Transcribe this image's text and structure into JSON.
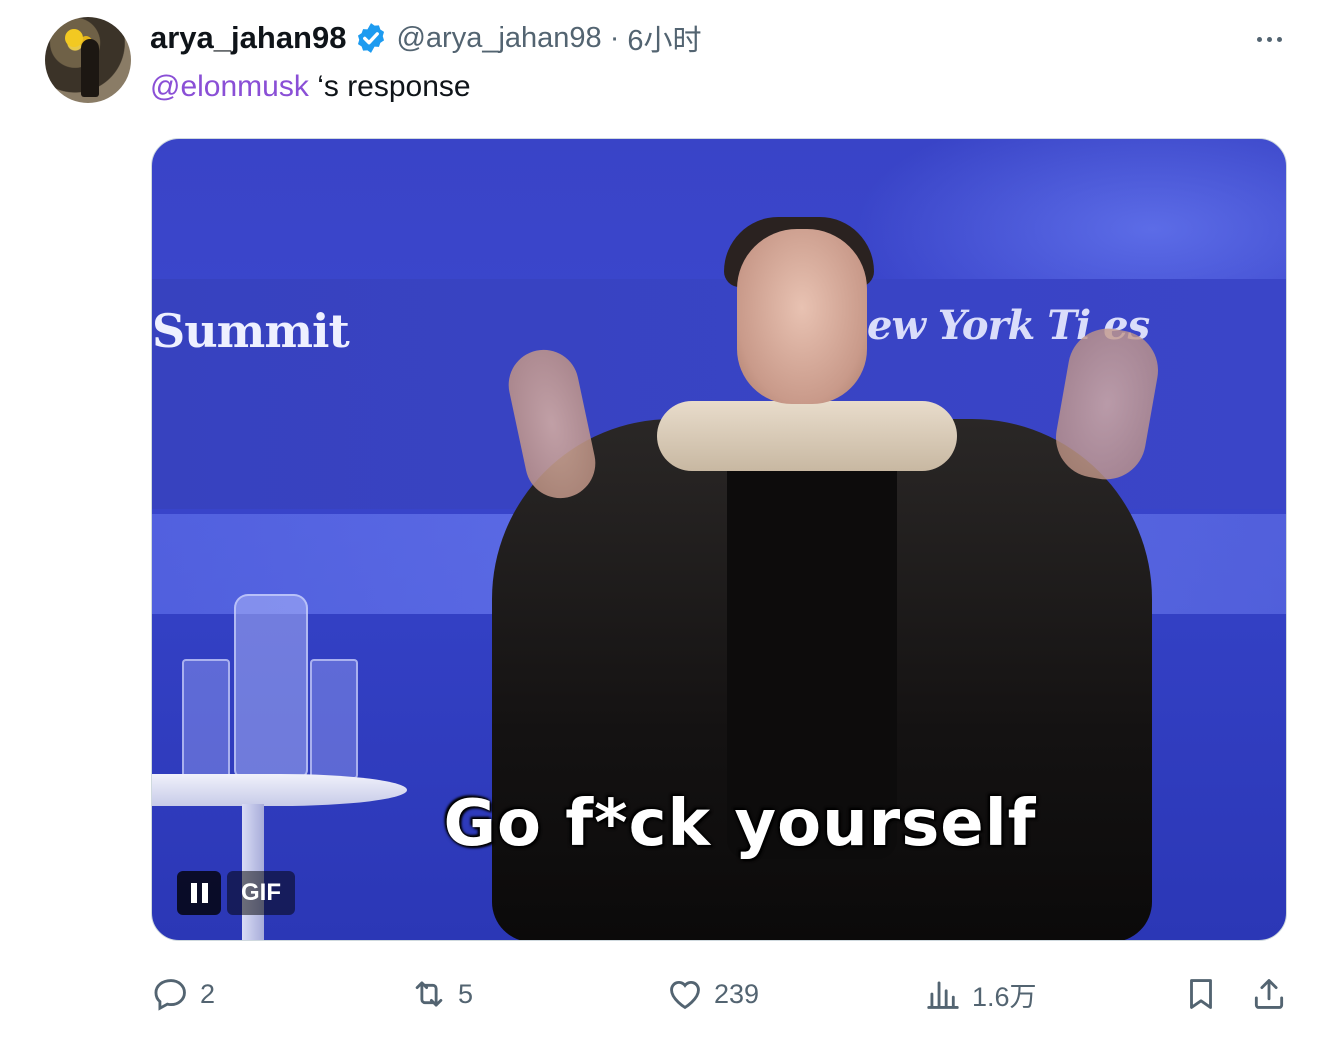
{
  "tweet": {
    "display_name": "arya_jahan98",
    "handle": "@arya_jahan98",
    "separator": "·",
    "time": "6小时",
    "mention": "@elonmusk",
    "text_rest": " ‘s response",
    "verified": true
  },
  "media": {
    "badge": "GIF",
    "caption": "Go f*ck yourself",
    "backdrop_left_text": "Summit",
    "backdrop_right_text": "ew York Ti  es"
  },
  "actions": {
    "replies": "2",
    "reposts": "5",
    "likes": "239",
    "views": "1.6万"
  },
  "colors": {
    "accent_mention": "#8a4fd6",
    "verified_blue": "#1d9bf0",
    "secondary_text": "#536471"
  }
}
